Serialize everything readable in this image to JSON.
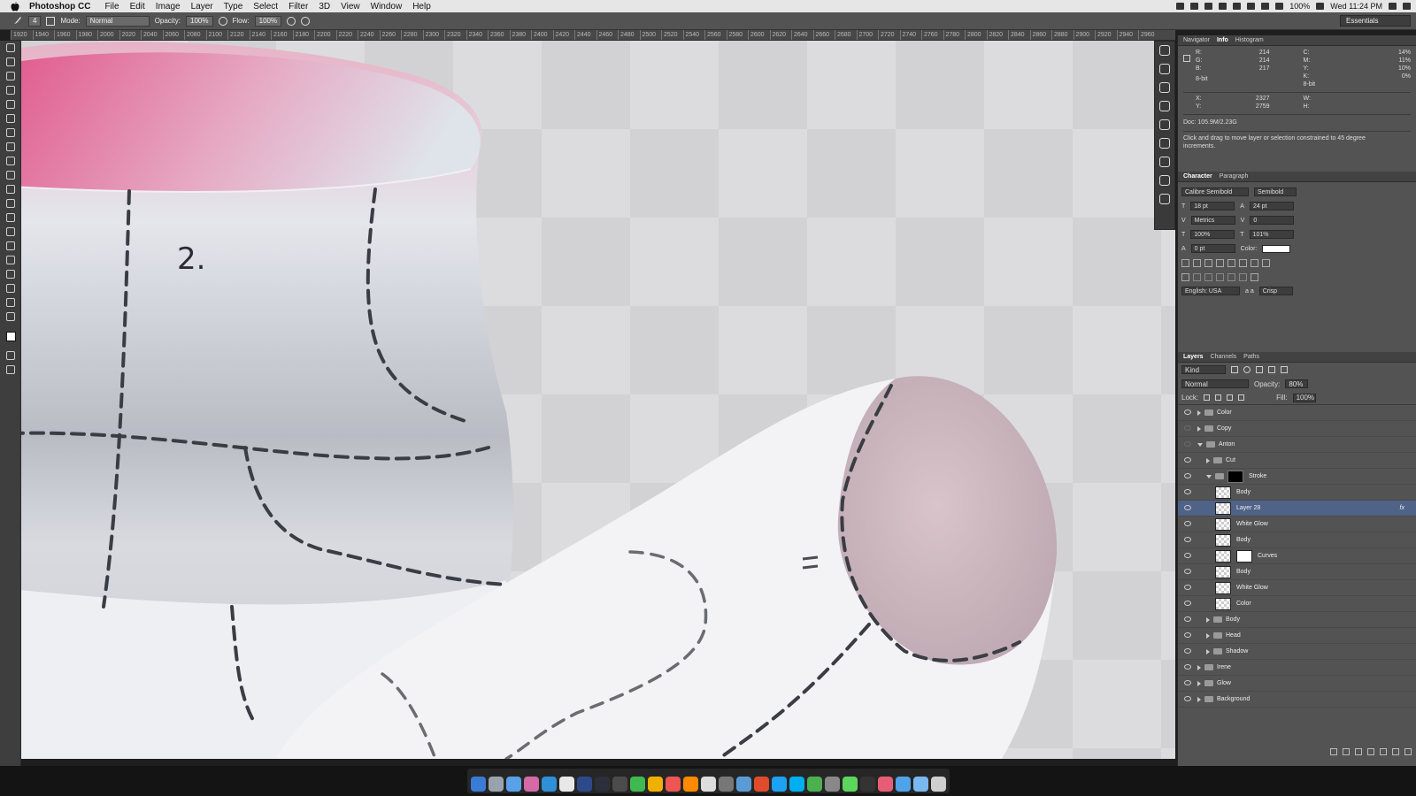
{
  "menubar": {
    "app": "Photoshop CC",
    "items": [
      "File",
      "Edit",
      "Image",
      "Layer",
      "Type",
      "Select",
      "Filter",
      "3D",
      "View",
      "Window",
      "Help"
    ],
    "battery": "100%",
    "clock": "Wed 11:24 PM"
  },
  "options": {
    "mode_label": "Mode:",
    "mode_value": "Normal",
    "opacity_label": "Opacity:",
    "opacity_value": "100%",
    "flow_label": "Flow:",
    "flow_value": "100%",
    "brush_size": "4",
    "workspace": "Essentials"
  },
  "ruler_ticks": [
    "1920",
    "1940",
    "1960",
    "1980",
    "2000",
    "2020",
    "2040",
    "2060",
    "2080",
    "2100",
    "2120",
    "2140",
    "2160",
    "2180",
    "2200",
    "2220",
    "2240",
    "2260",
    "2280",
    "2300",
    "2320",
    "2340",
    "2360",
    "2380",
    "2400",
    "2420",
    "2440",
    "2460",
    "2480",
    "2500",
    "2520",
    "2540",
    "2560",
    "2580",
    "2600",
    "2620",
    "2640",
    "2660",
    "2680",
    "2700",
    "2720",
    "2740",
    "2760",
    "2780",
    "2800",
    "2820",
    "2840",
    "2860",
    "2880",
    "2900",
    "2920",
    "2940",
    "2960"
  ],
  "canvas": {
    "annotation": "2."
  },
  "info_panel": {
    "tabs": [
      "Navigator",
      "Info",
      "Histogram"
    ],
    "active_tab": "Info",
    "r_label": "R:",
    "r": "214",
    "g_label": "G:",
    "g": "214",
    "b_label": "B:",
    "b": "217",
    "bitdepth": "8-bit",
    "c_label": "C:",
    "c": "14%",
    "m_label": "M:",
    "m": "11%",
    "y_label": "Y:",
    "y": "10%",
    "k_label": "K:",
    "k": "0%",
    "bitdepth2": "8-bit",
    "x_label": "X:",
    "x": "2327",
    "yy_label": "Y:",
    "yy": "2759",
    "w_label": "W:",
    "h_label": "H:",
    "doc": "Doc: 105.9M/2.23G",
    "hint": "Click and drag to move layer or selection constrained to 45 degree increments."
  },
  "character_panel": {
    "tabs": [
      "Character",
      "Paragraph"
    ],
    "font": "Calibre Semibold",
    "style": "Semibold",
    "size": "18 pt",
    "leading": "24 pt",
    "kerning": "Metrics",
    "tracking": "0",
    "vscale": "100%",
    "hscale": "101%",
    "baseline": "0 pt",
    "color_label": "Color:",
    "language": "English: USA",
    "aa_label": "a a",
    "aa": "Crisp"
  },
  "layers_panel": {
    "tabs": [
      "Layers",
      "Channels",
      "Paths"
    ],
    "kind": "Kind",
    "blend": "Normal",
    "opacity_label": "Opacity:",
    "opacity": "80%",
    "lock_label": "Lock:",
    "fill_label": "Fill:",
    "fill": "100%",
    "layers": [
      {
        "name": "Color",
        "type": "group",
        "indent": 0,
        "open": false,
        "eye": true
      },
      {
        "name": "Copy",
        "type": "group",
        "indent": 0,
        "open": false,
        "eye": false
      },
      {
        "name": "Anton",
        "type": "group",
        "indent": 0,
        "open": true,
        "eye": false
      },
      {
        "name": "Cut",
        "type": "group",
        "indent": 1,
        "open": false,
        "eye": true
      },
      {
        "name": "Stroke",
        "type": "group-mask",
        "indent": 1,
        "open": true,
        "eye": true
      },
      {
        "name": "Body",
        "type": "layer",
        "indent": 2,
        "eye": true
      },
      {
        "name": "Layer 28",
        "type": "layer",
        "indent": 2,
        "eye": true,
        "selected": true,
        "fx": "fx"
      },
      {
        "name": "White Glow",
        "type": "layer",
        "indent": 2,
        "eye": true
      },
      {
        "name": "Body",
        "type": "layer",
        "indent": 2,
        "eye": true
      },
      {
        "name": "Curves",
        "type": "adjust",
        "indent": 2,
        "eye": true
      },
      {
        "name": "Body",
        "type": "layer",
        "indent": 2,
        "eye": true
      },
      {
        "name": "White Glow",
        "type": "layer",
        "indent": 2,
        "eye": true
      },
      {
        "name": "Color",
        "type": "layer",
        "indent": 2,
        "eye": true
      },
      {
        "name": "Body",
        "type": "group",
        "indent": 1,
        "open": false,
        "eye": true
      },
      {
        "name": "Head",
        "type": "group",
        "indent": 1,
        "open": false,
        "eye": true
      },
      {
        "name": "Shadow",
        "type": "group",
        "indent": 1,
        "open": false,
        "eye": true
      },
      {
        "name": "Irene",
        "type": "group",
        "indent": 0,
        "open": false,
        "eye": true
      },
      {
        "name": "Glow",
        "type": "group",
        "indent": 0,
        "open": false,
        "eye": true
      },
      {
        "name": "Background",
        "type": "group",
        "indent": 0,
        "open": false,
        "eye": true
      }
    ]
  },
  "colors": {
    "ui_dark": "#535353",
    "selected_layer": "#4f6287",
    "pink": "#e15a8e",
    "dash": "#3a3d44"
  },
  "dock_count": 27
}
